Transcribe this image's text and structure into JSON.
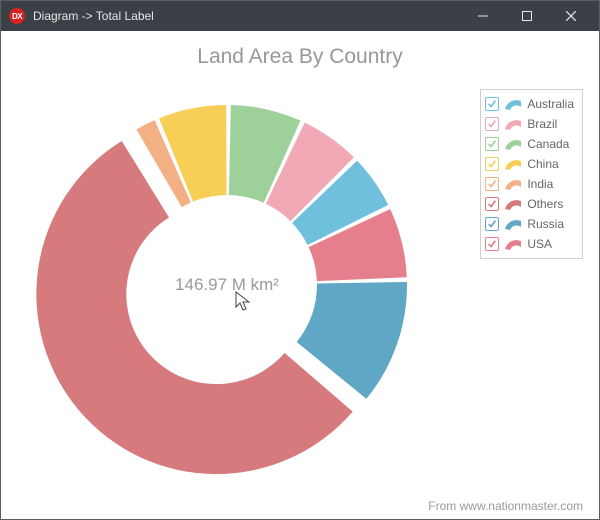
{
  "window": {
    "title": "Diagram -> Total Label"
  },
  "chart_data": {
    "type": "pie",
    "title": "Land Area By Country",
    "total_label": "146.97 M km²",
    "credit": "From www.nationmaster.com",
    "series": [
      {
        "name": "Australia",
        "value": 7.69,
        "color": "#70bfdd",
        "checked": true
      },
      {
        "name": "Brazil",
        "value": 8.51,
        "color": "#f2a9b6",
        "checked": true
      },
      {
        "name": "Canada",
        "value": 9.98,
        "color": "#9ed09a",
        "checked": true
      },
      {
        "name": "China",
        "value": 9.6,
        "color": "#f7ce56",
        "checked": true
      },
      {
        "name": "India",
        "value": 3.29,
        "color": "#f3b084",
        "checked": true
      },
      {
        "name": "Others",
        "value": 81.61,
        "color": "#d77a7d",
        "checked": true
      },
      {
        "name": "Russia",
        "value": 17.1,
        "color": "#60a7c6",
        "checked": true
      },
      {
        "name": "USA",
        "value": 9.83,
        "color": "#e57f8b",
        "checked": true
      }
    ],
    "slice_order": [
      "Others",
      "India",
      "China",
      "Canada",
      "Brazil",
      "Australia",
      "USA",
      "Russia"
    ],
    "exploded": "Others"
  }
}
